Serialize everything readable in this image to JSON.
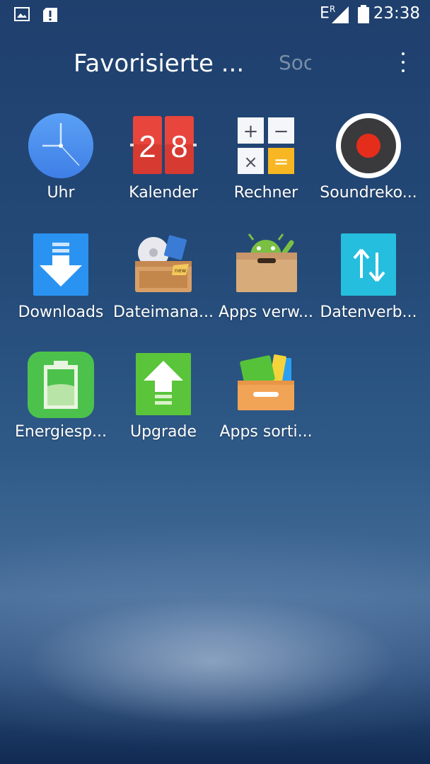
{
  "status_bar": {
    "left_icons": [
      "image-icon",
      "alert-icon"
    ],
    "network": "E",
    "network_sup": "R",
    "time": "23:38"
  },
  "header": {
    "tabs": [
      {
        "label": "Favorisierte ...",
        "active": true
      },
      {
        "label": "Soc",
        "active": false
      }
    ],
    "more_icon": "more-vert-icon"
  },
  "apps": [
    {
      "label": "Uhr",
      "icon": "clock-icon"
    },
    {
      "label": "Kalender",
      "icon": "calendar-icon",
      "icon_text": [
        "2",
        "8"
      ]
    },
    {
      "label": "Rechner",
      "icon": "calculator-icon",
      "icon_text": [
        "+",
        "−",
        "×",
        "="
      ]
    },
    {
      "label": "Soundreko...",
      "icon": "sound-recorder-icon"
    },
    {
      "label": "Downloads",
      "icon": "downloads-icon"
    },
    {
      "label": "Dateimana...",
      "icon": "file-manager-icon",
      "icon_text": [
        "new"
      ]
    },
    {
      "label": "Apps verw...",
      "icon": "app-manager-icon"
    },
    {
      "label": "Datenverb...",
      "icon": "data-transfer-icon"
    },
    {
      "label": "Energiesp...",
      "icon": "battery-saver-icon"
    },
    {
      "label": "Upgrade",
      "icon": "upgrade-icon"
    },
    {
      "label": "Apps sorti...",
      "icon": "apps-sort-icon"
    }
  ],
  "colors": {
    "clock_blue": "#4a8ef0",
    "calendar_red": "#e8453c",
    "calc_blue": "#3b9cf0",
    "calc_orange": "#f7b722",
    "recorder_red": "#e52d1c",
    "download_blue": "#2a93f2",
    "data_cyan": "#26bede",
    "battery_green": "#4cc24c",
    "upgrade_green": "#5ac43a",
    "folder_tan": "#d8ac7a"
  }
}
